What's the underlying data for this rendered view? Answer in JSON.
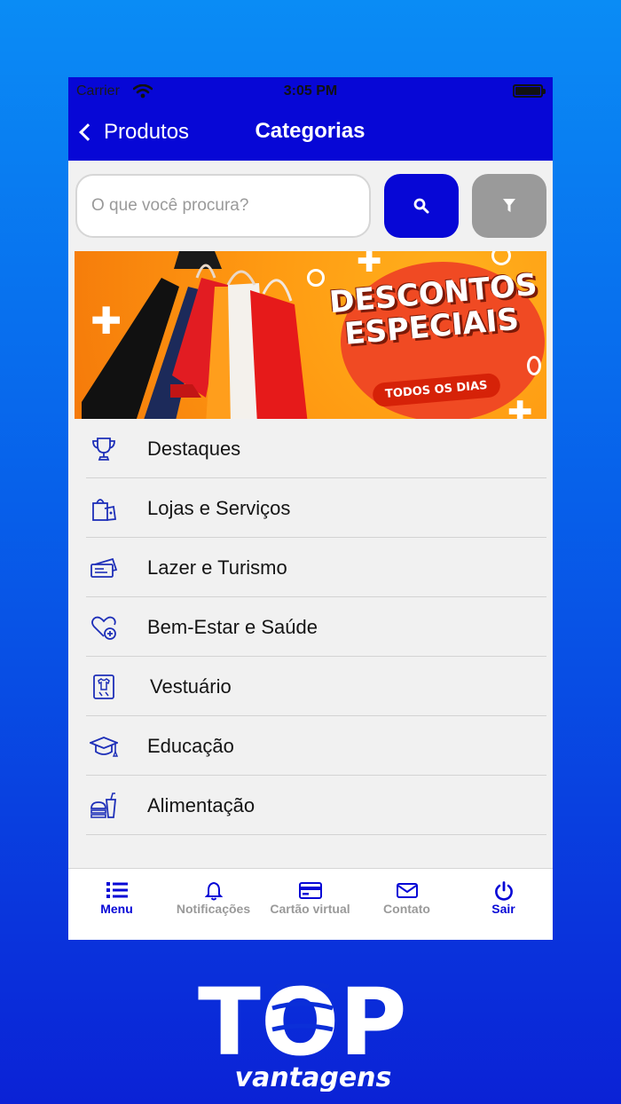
{
  "status": {
    "carrier": "Carrier",
    "time": "3:05 PM"
  },
  "nav": {
    "back_label": "Produtos",
    "title": "Categorias"
  },
  "search": {
    "placeholder": "O que você procura?"
  },
  "banner": {
    "title_line1": "DESCONTOS",
    "title_line2": "ESPECIAIS",
    "subtitle": "TODOS OS DIAS"
  },
  "categories": [
    {
      "label": "Destaques",
      "icon": "trophy-icon"
    },
    {
      "label": "Lojas e Serviços",
      "icon": "shopping-bags-icon"
    },
    {
      "label": "Lazer e Turismo",
      "icon": "tickets-icon"
    },
    {
      "label": "Bem-Estar e Saúde",
      "icon": "heart-plus-icon"
    },
    {
      "label": "Vestuário",
      "icon": "tshirt-icon"
    },
    {
      "label": "Educação",
      "icon": "graduation-cap-icon"
    },
    {
      "label": "Alimentação",
      "icon": "burger-drink-icon"
    }
  ],
  "tabs": [
    {
      "label": "Menu",
      "icon": "list-icon"
    },
    {
      "label": "Notificações",
      "icon": "bell-icon"
    },
    {
      "label": "Cartão virtual",
      "icon": "credit-card-icon"
    },
    {
      "label": "Contato",
      "icon": "envelope-icon"
    },
    {
      "label": "Sair",
      "icon": "power-icon"
    }
  ],
  "logo": {
    "top_text": "TOP",
    "bottom_text": "vantagens"
  },
  "colors": {
    "primary": "#0707d6",
    "filter_gray": "#9a9a9a",
    "banner_orange": "#ff9b12",
    "banner_red": "#f04a23"
  }
}
